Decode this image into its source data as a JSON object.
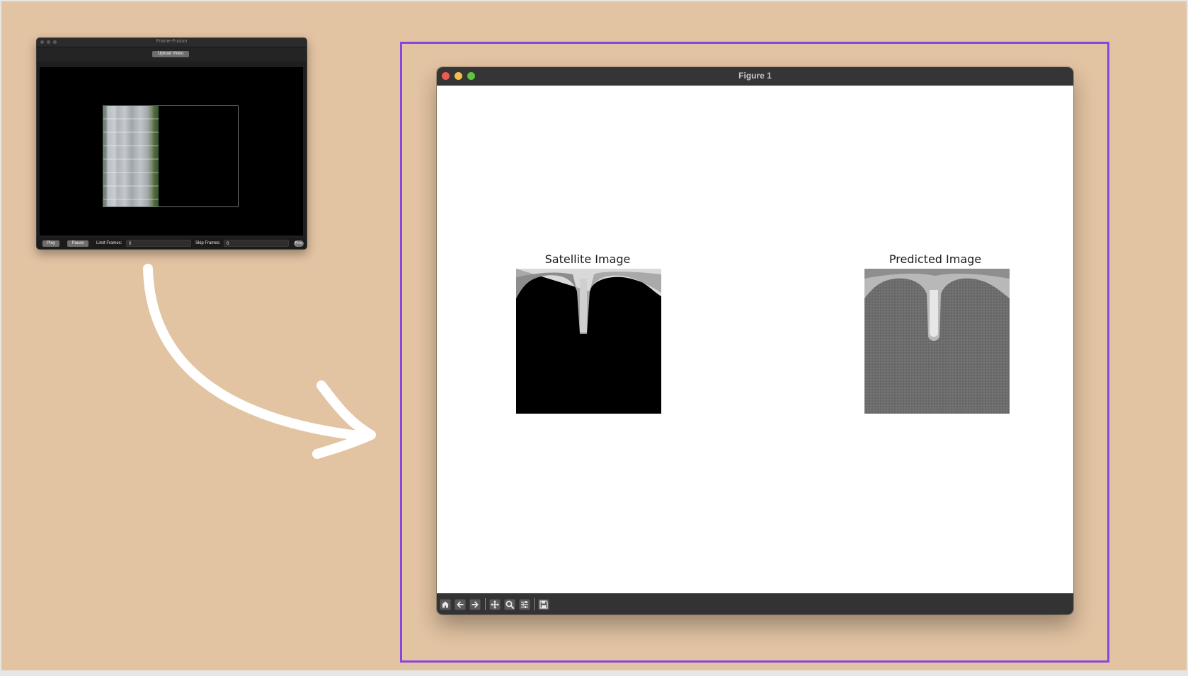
{
  "frame_fusion": {
    "title": "Frame-Fusion",
    "upload_button": "Upload Video",
    "play_button": "Play",
    "pause_button": "Pause",
    "limit_frames_label": "Limit Frames:",
    "limit_frames_value": "0",
    "skip_frames_label": "Skip Frames:",
    "skip_frames_value": "0",
    "round_button": "Proc"
  },
  "figure_window": {
    "title": "Figure 1",
    "subplots": [
      {
        "title": "Satellite Image"
      },
      {
        "title": "Predicted Image"
      }
    ],
    "toolbar": {
      "icons": [
        "home-icon",
        "back-arrow-icon",
        "forward-arrow-icon",
        "pan-icon",
        "zoom-icon",
        "configure-subplots-icon",
        "save-icon"
      ]
    }
  },
  "colors": {
    "background": "#e2c3a2",
    "highlight": "#8a44e0",
    "arrow": "#ffffff"
  }
}
